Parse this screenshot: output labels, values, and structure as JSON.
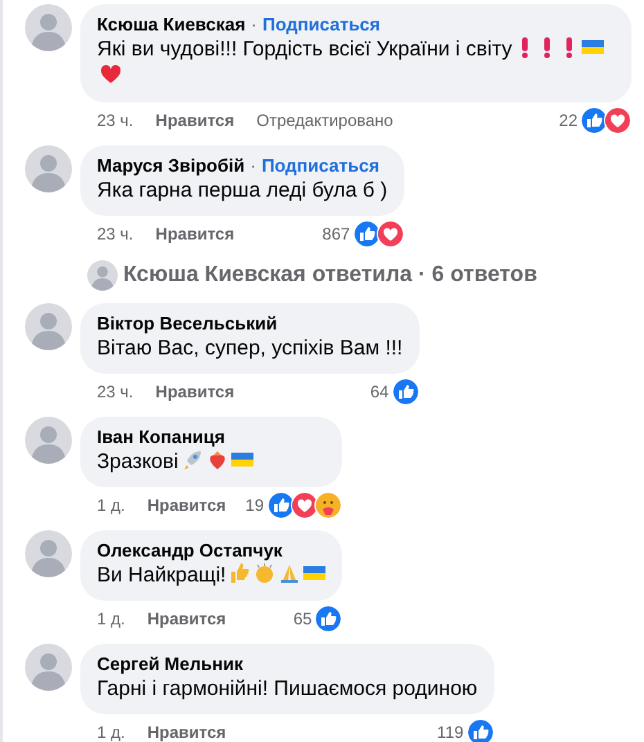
{
  "comments": [
    {
      "author": "Ксюша Киевская",
      "separator": "·",
      "follow": "Подписаться",
      "text": "Які ви чудові!!! Гордість всієї України і світу",
      "emojis": [
        {
          "kind": "exclamation"
        },
        {
          "kind": "exclamation"
        },
        {
          "kind": "exclamation"
        },
        {
          "kind": "flag"
        },
        {
          "kind": "heart"
        }
      ],
      "time": "23 ч.",
      "like": "Нравится",
      "edited": "Отредактировано",
      "count": "22",
      "reactions": [
        {
          "kind": "like"
        },
        {
          "kind": "love"
        }
      ]
    },
    {
      "author": "Маруся Звіробій",
      "separator": "·",
      "follow": "Подписаться",
      "text": "Яка гарна перша леді була б )",
      "time": "23 ч.",
      "like": "Нравится",
      "count": "867",
      "reactions": [
        {
          "kind": "like"
        },
        {
          "kind": "love"
        }
      ]
    }
  ],
  "replies_summary": {
    "text": "Ксюша Киевская ответила · 6 ответов"
  },
  "replies": [
    {
      "author": "Віктор Весельський",
      "text": "Вітаю Вас, супер, успіхів Вам !!!",
      "time": "23 ч.",
      "like": "Нравится",
      "count": "64",
      "reactions": [
        {
          "kind": "like"
        }
      ]
    },
    {
      "author": "Іван Копаниця",
      "text": "Зразкові",
      "emojis": [
        {
          "kind": "rocket"
        },
        {
          "kind": "strawberry"
        },
        {
          "kind": "flag"
        }
      ],
      "time": "1 д.",
      "like": "Нравится",
      "count": "19",
      "reactions": [
        {
          "kind": "like"
        },
        {
          "kind": "love"
        },
        {
          "kind": "care"
        }
      ]
    },
    {
      "author": "Олександр Остапчук",
      "text": "Ви Найкращі!",
      "emojis": [
        {
          "kind": "thumbs"
        },
        {
          "kind": "clap"
        },
        {
          "kind": "pray"
        },
        {
          "kind": "flag"
        }
      ],
      "time": "1 д.",
      "like": "Нравится",
      "count": "65",
      "reactions": [
        {
          "kind": "like"
        }
      ]
    },
    {
      "author": "Сергей Мельник",
      "text": "Гарні і гармонійні! Пишаємося родиною",
      "time": "1 д.",
      "like": "Нравится",
      "count": "119",
      "reactions": [
        {
          "kind": "like"
        }
      ]
    }
  ]
}
